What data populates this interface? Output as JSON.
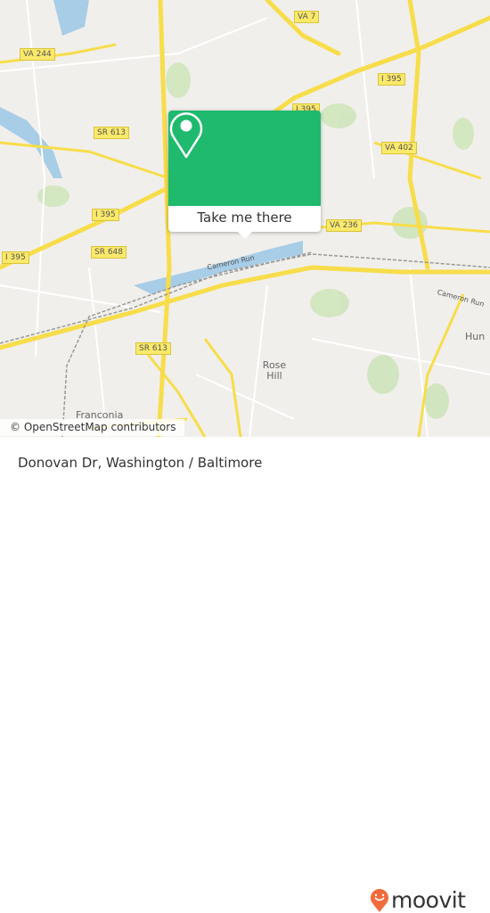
{
  "map": {
    "road_shields": [
      "VA 7",
      "VA 244",
      "I 395",
      "I 395",
      "SR 613",
      "VA 402",
      "I 395",
      "VA 236",
      "SR 648",
      "I 395",
      "SR 613"
    ],
    "places": [
      "Rose Hill",
      "Franconia",
      "Hun"
    ],
    "streets": [
      "Cameron Run",
      "Cameron Run"
    ],
    "colors": {
      "background": "#f1efeb",
      "major_road": "#f7dd4a",
      "water": "#a7cde7",
      "park": "#cfe5bd"
    }
  },
  "popup": {
    "icon": "map-pin-icon",
    "button_label": "Take me there",
    "color": "#1fba6d"
  },
  "attribution": "© OpenStreetMap contributors",
  "footer": {
    "location_title": "Donovan Dr, Washington / Baltimore",
    "logo_text": "moovit",
    "logo_color": "#f26b3a"
  }
}
